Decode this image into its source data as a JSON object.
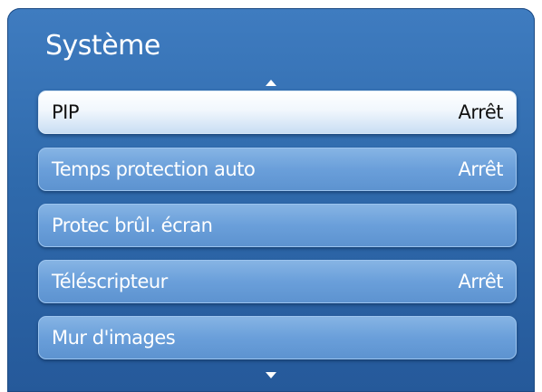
{
  "panel": {
    "title": "Système"
  },
  "menu": {
    "items": [
      {
        "label": "PIP",
        "value": "Arrêt",
        "selected": true
      },
      {
        "label": "Temps protection auto",
        "value": "Arrêt"
      },
      {
        "label": "Protec brûl. écran",
        "value": ""
      },
      {
        "label": "Téléscripteur",
        "value": "Arrêt"
      },
      {
        "label": "Mur d'images",
        "value": ""
      }
    ]
  },
  "icons": {
    "scroll_up": "scroll-up-arrow-icon",
    "scroll_down": "scroll-down-arrow-icon"
  },
  "colors": {
    "panel_background": "#2f6aac",
    "item_background": "#6a9fda",
    "selected_item_background": "#f1f7fd",
    "text": "#ffffff",
    "selected_text": "#111111"
  }
}
